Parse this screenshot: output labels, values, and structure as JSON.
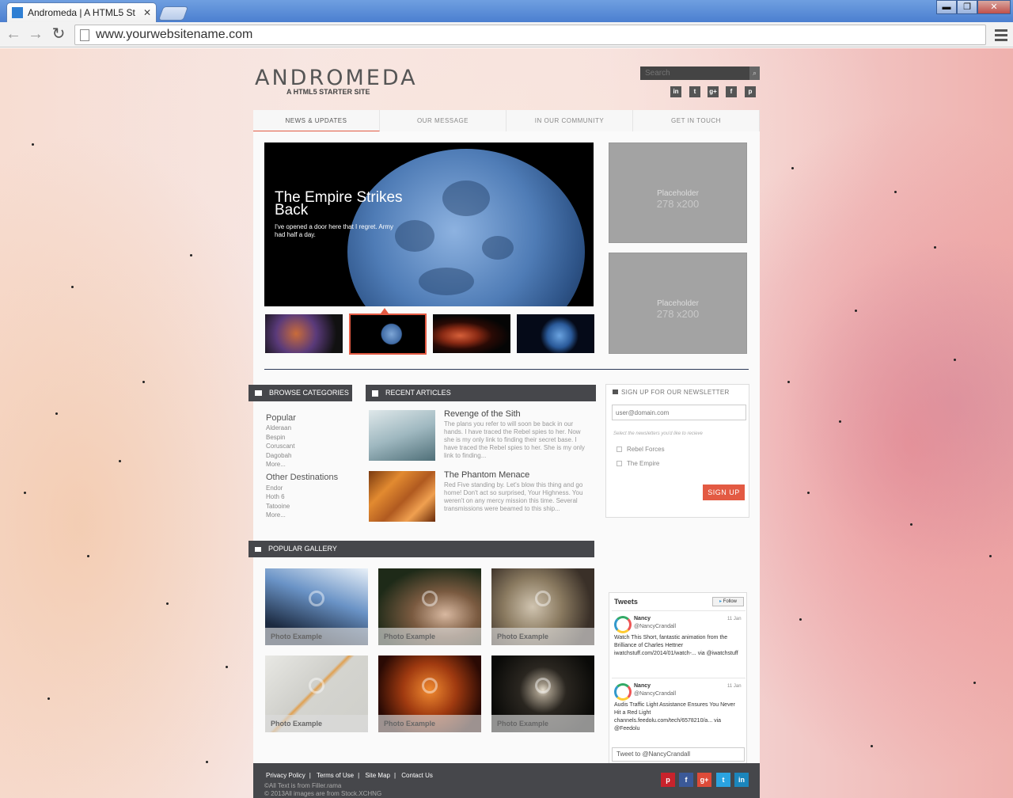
{
  "browser": {
    "tab_title": "Andromeda | A HTML5 St",
    "tab_close": "✕",
    "url": "www.yourwebsitename.com",
    "win_minimize": "▬",
    "win_restore": "❐",
    "win_close": "✕"
  },
  "site": {
    "logo": "ANDROMEDA",
    "tagline": "A HTML5 STARTER SITE",
    "search_placeholder": "Search",
    "social_icons": [
      "linkedin-icon",
      "twitter-icon",
      "googleplus-icon",
      "facebook-icon",
      "pinterest-icon"
    ],
    "social_labels": [
      "in",
      "t",
      "g+",
      "f",
      "p"
    ],
    "nav": [
      "NEWS & UPDATES",
      "OUR MESSAGE",
      "IN OUR COMMUNITY",
      "GET IN TOUCH"
    ],
    "slider": {
      "title": "The Empire Strikes Back",
      "subtitle": "I've opened a door here that I regret. Army had half a day."
    },
    "placeholders": [
      {
        "label": "Placeholder",
        "size": "278 x200"
      },
      {
        "label": "Placeholder",
        "size": "278 x200"
      }
    ],
    "categories": {
      "heading": "BROWSE CATEGORIES",
      "group1_title": "Popular",
      "group1_items": [
        "Alderaan",
        "Bespin",
        "Coruscant",
        "Dagobah",
        "More..."
      ],
      "group2_title": "Other Destinations",
      "group2_items": [
        "Endor",
        "Hoth 6",
        "Tatooine",
        "More..."
      ]
    },
    "articles": {
      "heading": "RECENT ARTICLES",
      "items": [
        {
          "title": "Revenge of the Sith",
          "text": "The plans you refer to will soon be back in our hands. I have traced the Rebel spies to her. Now she is my only link to finding their secret base. I have traced the Rebel spies to her. She is my only link to finding..."
        },
        {
          "title": "The Phantom Menace",
          "text": "Red Five standing by. Let's blow this thing and go home! Don't act so surprised, Your Highness. You weren't on any mercy mission this time. Several transmissions were beamed to this ship..."
        }
      ]
    },
    "newsletter": {
      "heading": "SIGN UP FOR OUR NEWSLETTER",
      "email_placeholder": "user@domain.com",
      "hint": "Select the newsletters you'd like to recieve",
      "options": [
        "Rebel Forces",
        "The Empire"
      ],
      "button": "SIGN UP"
    },
    "gallery": {
      "heading": "POPULAR GALLERY",
      "captions": [
        "Photo Example",
        "Photo Example",
        "Photo Example",
        "Photo Example",
        "Photo Example",
        "Photo Example"
      ]
    },
    "tweets": {
      "heading": "Tweets",
      "follow": "Follow",
      "items": [
        {
          "name": "Nancy",
          "handle": "@NancyCrandall",
          "date": "11 Jan",
          "text": "Watch This Short, fantastic animation from the Brilliance of Charles Hettner iwatchstuff.com/2014/01/watch-... via @iwatchstuff"
        },
        {
          "name": "Nancy",
          "handle": "@NancyCrandall",
          "date": "11 Jan",
          "text": "Audis Traffic Light Assistance Ensures You Never Hit a Red Light channels.feedolu.com/tech/6578210/a... via @Feedolu"
        }
      ],
      "tweet_to": "Tweet to @NancyCrandall"
    },
    "footer": {
      "links": [
        "Privacy Policy",
        "Terms of Use",
        "Site Map",
        "Contact Us"
      ],
      "separator": "|",
      "copy1": "©All Text is from Filler.rama",
      "copy2": "© 2013All images are from Stock.XCHNG",
      "social_icons": [
        "pinterest-icon",
        "facebook-icon",
        "googleplus-icon",
        "twitter-icon",
        "linkedin-icon"
      ],
      "social_labels": [
        "p",
        "f",
        "g+",
        "t",
        "in"
      ]
    }
  }
}
